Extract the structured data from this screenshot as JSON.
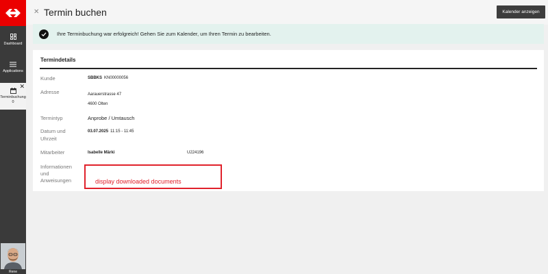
{
  "header": {
    "title": "Termin buchen",
    "calendar_button": "Kalender anzeigen"
  },
  "sidebar": {
    "items": [
      {
        "label": "Dashboard",
        "icon": "grid-icon"
      },
      {
        "label": "Applications",
        "icon": "menu-icon"
      },
      {
        "label": "Terminbuchung",
        "icon": "calendar-icon",
        "count": "0"
      }
    ],
    "user_name": "Rene"
  },
  "banner": {
    "message": "Ihre Terminbuchung war erfolgreich! Gehen Sie zum Kalender, um Ihren Termin zu bearbeiten."
  },
  "card": {
    "title": "Termindetails",
    "kunde_label": "Kunde",
    "kunde_name": "SBBKS",
    "kunde_nr": "KN00000056",
    "adresse_label": "Adresse",
    "adresse_line1": "Aarauerstrasse 47",
    "adresse_line2": "4600 Olten",
    "termintyp_label": "Termintyp",
    "termintyp_value": "Anprobe / Umtausch",
    "datum_label_1": "Datum und",
    "datum_label_2": "Uhrzeit",
    "datum_date": "03.07.2025",
    "datum_time": "11:15 - 11:45",
    "mitarbeiter_label": "Mitarbeiter",
    "mitarbeiter_name": "Isabelle Märki",
    "mitarbeiter_id": "U224196",
    "info_label_1": "Informationen",
    "info_label_2": "und",
    "info_label_3": "Anweisungen"
  },
  "annotation": {
    "text": "display downloaded documents",
    "color": "#e0202a"
  },
  "colors": {
    "brand_red": "#eb0000",
    "sidebar_bg": "#3a3a3a",
    "banner_bg": "#e3f2ee",
    "button_bg": "#3d3d3d"
  }
}
